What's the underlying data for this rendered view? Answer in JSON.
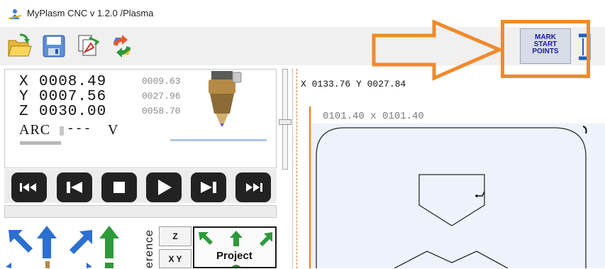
{
  "window": {
    "title": "MyPlasm CNC v 1.2.0  /Plasma"
  },
  "toolbar": {
    "tools": [
      {
        "icon": "open-folder-icon"
      },
      {
        "icon": "save-disk-icon"
      },
      {
        "icon": "edit-document-icon"
      },
      {
        "icon": "refresh-arrows-icon"
      }
    ],
    "mark_start_points": [
      "MARK",
      "START",
      "POINTS"
    ]
  },
  "coordinates": {
    "x_label": "X",
    "x_value": "0008.49",
    "x_secondary": "0009.63",
    "y_label": "Y",
    "y_value": "0007.56",
    "y_secondary": "0027.96",
    "z_label": "Z",
    "z_value": "0030.00",
    "z_secondary": "0058.70",
    "status_arc": "ARC",
    "status_dashes": "---",
    "status_v": "V"
  },
  "transport": {
    "buttons": [
      "rewind",
      "step-back",
      "stop",
      "play",
      "step-forward",
      "fast-forward"
    ]
  },
  "jog": {
    "reference_label": "erence",
    "z_button": "Z",
    "xy_button": "X Y",
    "project_button": "Project"
  },
  "canvas": {
    "readout": "X 0133.76  Y 0027.84",
    "dimensions": "0101.40 x  0101.40"
  },
  "colors": {
    "highlight": "#f08a2c",
    "accent_blue": "#1f5fbf",
    "jog_green": "#2e9a3a"
  }
}
